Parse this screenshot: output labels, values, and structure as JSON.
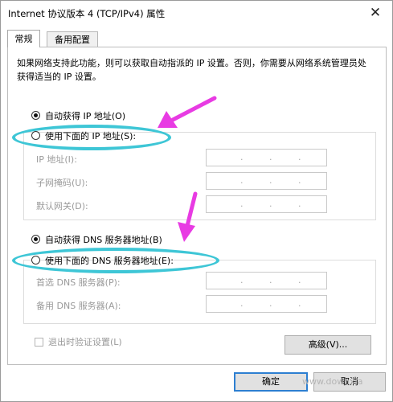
{
  "window": {
    "title": "Internet 协议版本 4 (TCP/IPv4) 属性",
    "close_glyph": "✕"
  },
  "tabs": [
    {
      "label": "常规",
      "active": true
    },
    {
      "label": "备用配置",
      "active": false
    }
  ],
  "description": "如果网络支持此功能，则可以获取自动指派的 IP 设置。否则，你需要从网络系统管理员处获得适当的 IP 设置。",
  "ip_section": {
    "auto_label": "自动获得 IP 地址(O)",
    "auto_selected": true,
    "manual_label": "使用下面的 IP 地址(S):",
    "manual_selected": false,
    "fields": [
      {
        "label": "IP 地址(I):",
        "value": ""
      },
      {
        "label": "子网掩码(U):",
        "value": ""
      },
      {
        "label": "默认网关(D):",
        "value": ""
      }
    ]
  },
  "dns_section": {
    "auto_label": "自动获得 DNS 服务器地址(B)",
    "auto_selected": true,
    "manual_label": "使用下面的 DNS 服务器地址(E):",
    "manual_selected": false,
    "fields": [
      {
        "label": "首选 DNS 服务器(P):",
        "value": ""
      },
      {
        "label": "备用 DNS 服务器(A):",
        "value": ""
      }
    ]
  },
  "validate_on_exit": {
    "label": "退出时验证设置(L)",
    "checked": false
  },
  "buttons": {
    "advanced": "高级(V)...",
    "ok": "确定",
    "cancel": "取消"
  },
  "ip_dot": ".",
  "watermark": "www.downxia",
  "colors": {
    "annotation_ellipse": "#3ec6d6",
    "annotation_arrow": "#e83be3",
    "ok_border": "#2d7fd1"
  }
}
